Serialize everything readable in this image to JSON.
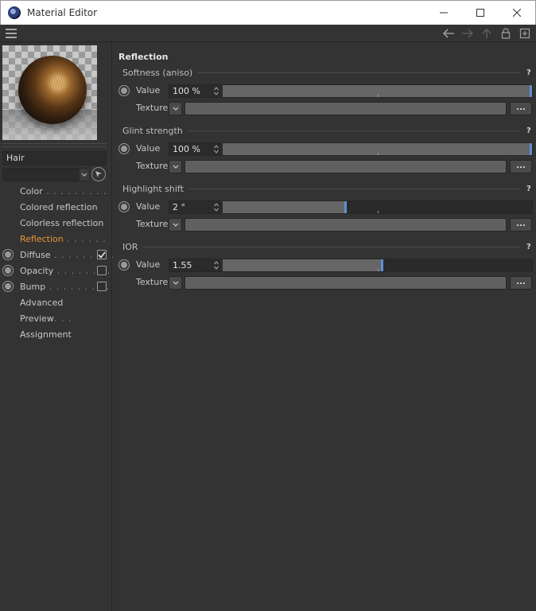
{
  "window": {
    "title": "Material Editor"
  },
  "preview": {
    "material_name": "Hair"
  },
  "channels": [
    {
      "label": "Color",
      "dots": " . . . . . . . . .",
      "has_radio": false,
      "checkbox": null,
      "active": false
    },
    {
      "label": "Colored reflection",
      "dots": "",
      "has_radio": false,
      "checkbox": null,
      "active": false
    },
    {
      "label": "Colorless reflection",
      "dots": "",
      "has_radio": false,
      "checkbox": null,
      "active": false
    },
    {
      "label": "Reflection",
      "dots": " . . . . . .",
      "has_radio": false,
      "checkbox": null,
      "active": true
    },
    {
      "label": "Diffuse",
      "dots": " . . . . . . . . .",
      "has_radio": true,
      "checkbox": true,
      "active": false
    },
    {
      "label": "Opacity",
      "dots": " . . . . . . . .",
      "has_radio": true,
      "checkbox": false,
      "active": false
    },
    {
      "label": "Bump",
      "dots": " . . . . . . . . .",
      "has_radio": true,
      "checkbox": false,
      "active": false
    },
    {
      "label": "Advanced",
      "dots": "",
      "has_radio": false,
      "checkbox": null,
      "active": false
    },
    {
      "label": "Preview",
      "dots": ". . .",
      "has_radio": false,
      "checkbox": null,
      "active": false
    },
    {
      "label": "Assignment",
      "dots": "",
      "has_radio": false,
      "checkbox": null,
      "active": false
    }
  ],
  "section": {
    "title": "Reflection"
  },
  "groups": [
    {
      "title": "Softness (aniso)",
      "help": "?",
      "value_label": "Value",
      "value": "100 %",
      "level": 1.0,
      "texture_label": "Texture",
      "more": "..."
    },
    {
      "title": "Glint strength",
      "help": "?",
      "value_label": "Value",
      "value": "100 %",
      "level": 1.0,
      "texture_label": "Texture",
      "more": "..."
    },
    {
      "title": "Highlight shift",
      "help": "?",
      "value_label": "Value",
      "value": "2 °",
      "level": 0.4,
      "texture_label": "Texture",
      "more": "..."
    },
    {
      "title": "IOR",
      "help": "?",
      "value_label": "Value",
      "value": "1.55",
      "level": 0.52,
      "texture_label": "Texture",
      "more": "..."
    }
  ]
}
